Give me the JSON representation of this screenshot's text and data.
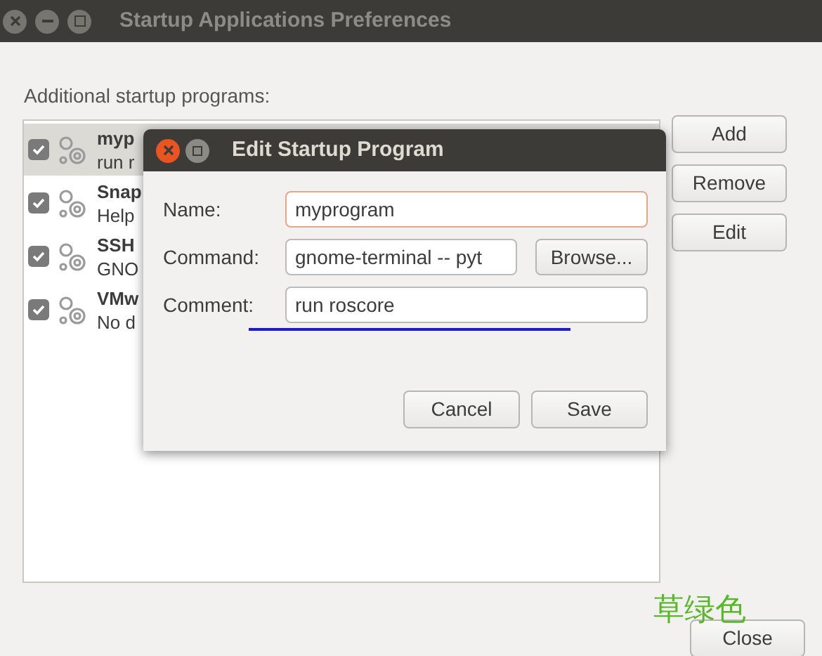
{
  "window": {
    "title": "Startup Applications Preferences"
  },
  "list_label": "Additional startup programs:",
  "programs": [
    {
      "name": "myp",
      "description": "run r",
      "checked": true,
      "selected": true
    },
    {
      "name": "Snap",
      "description": "Help",
      "checked": true,
      "selected": false
    },
    {
      "name": "SSH",
      "description": "GNO",
      "checked": true,
      "selected": false
    },
    {
      "name": "VMw",
      "description": "No d",
      "checked": true,
      "selected": false
    }
  ],
  "side_buttons": [
    "Add",
    "Remove",
    "Edit"
  ],
  "close_button": "Close",
  "annotation": "草绿色",
  "dialog": {
    "title": "Edit Startup Program",
    "fields": [
      {
        "label": "Name:",
        "value": "myprogram",
        "focused": true
      },
      {
        "label": "Command:",
        "value": "gnome-terminal -- pyt",
        "focused": false,
        "button": "Browse..."
      },
      {
        "label": "Comment:",
        "value": "run roscore",
        "focused": false
      }
    ],
    "buttons": [
      "Cancel",
      "Save"
    ]
  }
}
